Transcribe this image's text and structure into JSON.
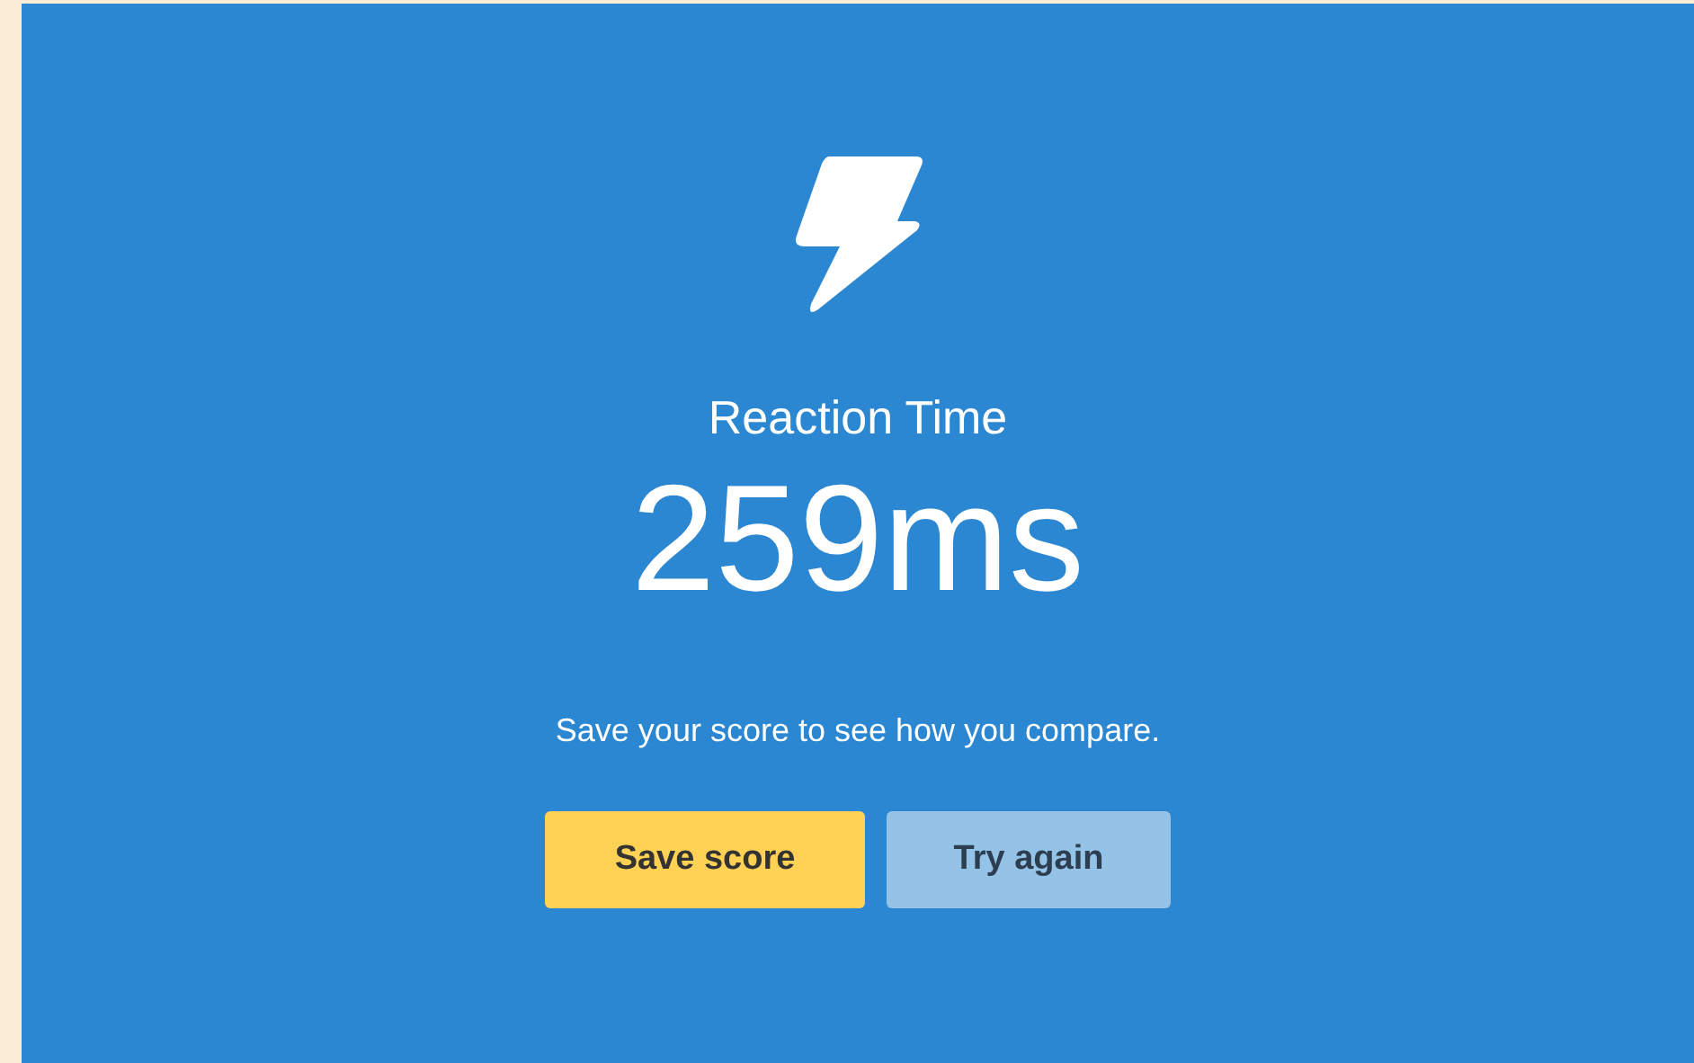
{
  "result": {
    "title": "Reaction Time",
    "score": "259ms",
    "message": "Save your score to see how you compare."
  },
  "buttons": [
    {
      "label": "Save score",
      "kind": "primary"
    },
    {
      "label": "Try again",
      "kind": "secondary"
    }
  ]
}
